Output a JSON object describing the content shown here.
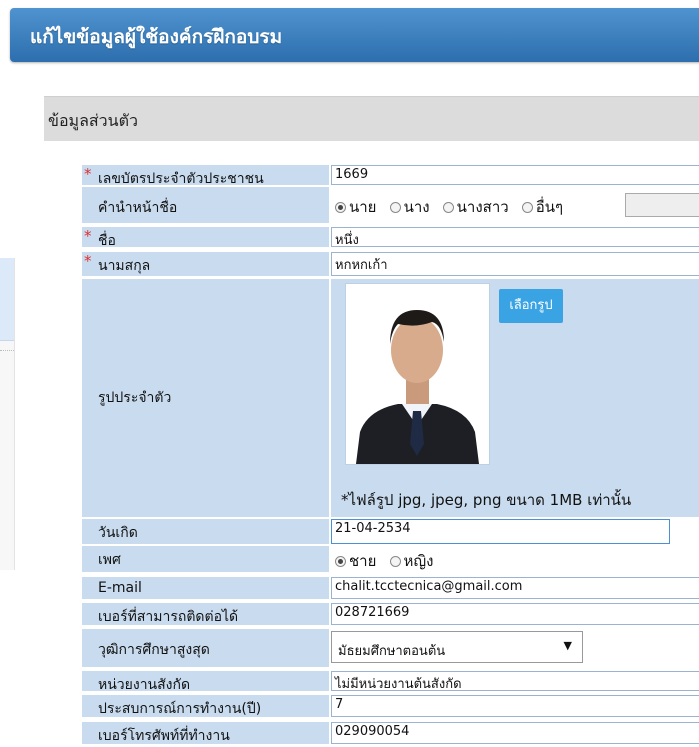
{
  "header": {
    "title": "แก้ไขข้อมูลผู้ใช้องค์กรฝึกอบรม"
  },
  "section": {
    "title": "ข้อมูลส่วนตัว"
  },
  "fields": {
    "id_card": {
      "label": "เลขบัตรประจำตัวประชาชน",
      "value": "1669",
      "required": "*"
    },
    "prefix": {
      "label": "คำนำหน้าชื่อ",
      "options": [
        "นาย",
        "นาง",
        "นางสาว",
        "อื่นๆ"
      ],
      "selected": "นาย",
      "other_value": ""
    },
    "first_name": {
      "label": "ชื่อ",
      "value": "หนึ่ง",
      "required": "*"
    },
    "last_name": {
      "label": "นามสกุล",
      "value": "หกหกเก้า",
      "required": "*"
    },
    "photo": {
      "label": "รูปประจำตัว",
      "button": "เลือกรูป",
      "note": "*ไฟล์รูป jpg, jpeg, png ขนาด 1MB เท่านั้น"
    },
    "birthdate": {
      "label": "วันเกิด",
      "value": "21-04-2534"
    },
    "gender": {
      "label": "เพศ",
      "options": [
        "ชาย",
        "หญิง"
      ],
      "selected": "ชาย"
    },
    "email": {
      "label": "E-mail",
      "value": "chalit.tcctecnica@gmail.com"
    },
    "phone": {
      "label": "เบอร์ที่สามารถติดต่อได้",
      "value": "028721669"
    },
    "education": {
      "label": "วุฒิการศึกษาสูงสุด",
      "value": "มัธยมศึกษาตอนต้น"
    },
    "agency": {
      "label": "หน่วยงานสังกัด",
      "value": "ไม่มีหน่วยงานต้นสังกัด"
    },
    "experience": {
      "label": "ประสบการณ์การทำงาน(ปี)",
      "value": "7"
    },
    "work_phone": {
      "label": "เบอร์โทรศัพท์ที่ทำงาน",
      "value": "029090054"
    }
  }
}
